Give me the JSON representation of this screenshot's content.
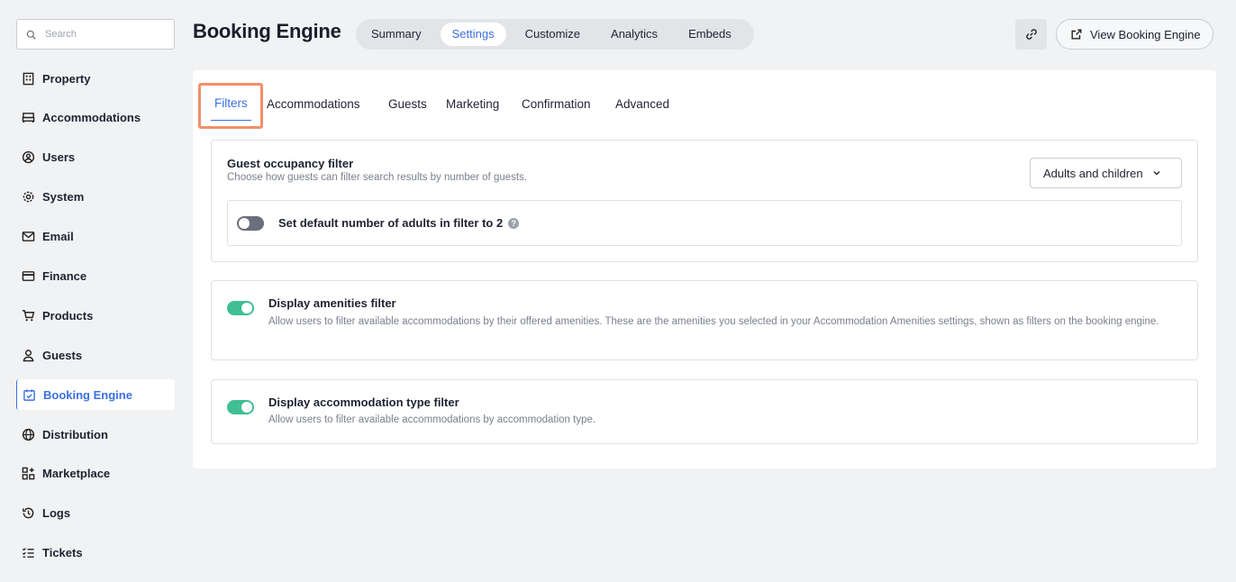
{
  "search": {
    "placeholder": "Search"
  },
  "sidebar": {
    "items": [
      {
        "label": "Property",
        "icon": "building-icon"
      },
      {
        "label": "Accommodations",
        "icon": "bed-icon"
      },
      {
        "label": "Users",
        "icon": "user-circle-icon"
      },
      {
        "label": "System",
        "icon": "gear-icon"
      },
      {
        "label": "Email",
        "icon": "mail-icon"
      },
      {
        "label": "Finance",
        "icon": "credit-card-icon"
      },
      {
        "label": "Products",
        "icon": "cart-icon"
      },
      {
        "label": "Guests",
        "icon": "person-icon"
      },
      {
        "label": "Booking Engine",
        "icon": "calendar-check-icon",
        "active": true
      },
      {
        "label": "Distribution",
        "icon": "globe-icon"
      },
      {
        "label": "Marketplace",
        "icon": "apps-icon"
      },
      {
        "label": "Logs",
        "icon": "history-icon"
      },
      {
        "label": "Tickets",
        "icon": "list-check-icon"
      }
    ]
  },
  "header": {
    "title": "Booking Engine",
    "tabs": [
      "Summary",
      "Settings",
      "Customize",
      "Analytics",
      "Embeds"
    ],
    "active_tab": "Settings",
    "link_button_icon": "link-icon",
    "view_button_label": "View Booking Engine",
    "view_button_icon": "external-link-icon"
  },
  "subtabs": {
    "items": [
      "Filters",
      "Accommodations",
      "Guests",
      "Marketing",
      "Confirmation",
      "Advanced"
    ],
    "active": "Filters"
  },
  "guest_occupancy": {
    "title": "Guest occupancy filter",
    "description": "Choose how guests can filter search results by number of guests.",
    "select_value": "Adults and children",
    "default_adults_label": "Set default number of adults in filter to 2",
    "default_adults_enabled": false
  },
  "amenities": {
    "title": "Display amenities filter",
    "description": "Allow users to filter available accommodations by their offered amenities. These are the amenities you selected in your Accommodation Amenities settings, shown as filters on the booking engine.",
    "enabled": true
  },
  "accommodation_type": {
    "title": "Display accommodation type filter",
    "description": "Allow users to filter available accommodations by accommodation type.",
    "enabled": true
  },
  "colors": {
    "accent": "#3c6fe0",
    "toggle_on": "#3fbf93",
    "toggle_off": "#6b6f7b",
    "highlight": "#f28f6b"
  }
}
